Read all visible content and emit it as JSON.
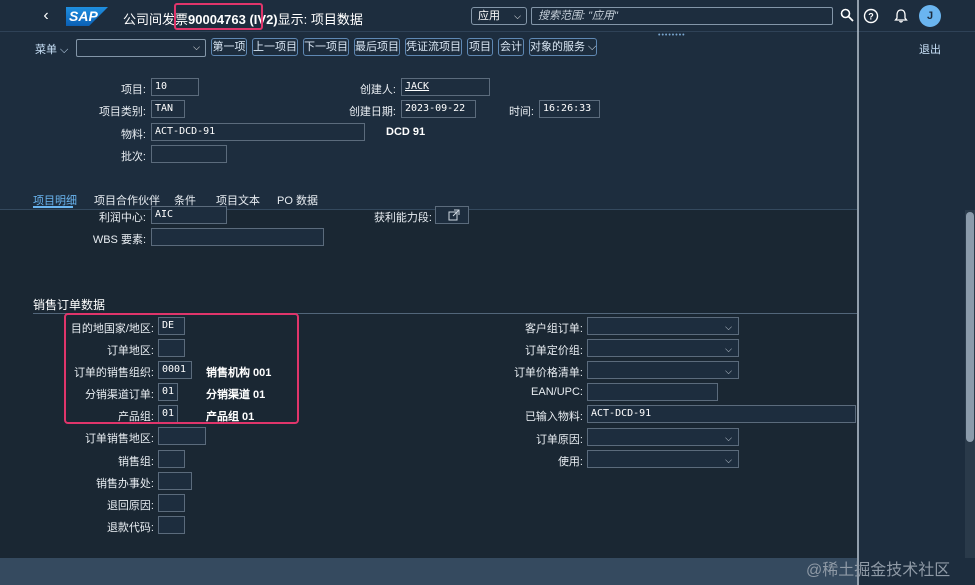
{
  "shell": {
    "title_prefix": "公司间发票",
    "doc_number": "90004763 (IV2)",
    "title_suffix": "显示: 项目数据",
    "scope": "应用",
    "search_placeholder": "搜索范围: \"应用\"",
    "avatar_initial": "J",
    "icons": [
      "back-icon",
      "search-icon",
      "help-icon",
      "bell-icon",
      "chevron-down-icon"
    ]
  },
  "toolbar": {
    "menu": "菜单",
    "buttons": [
      "第一项",
      "上一项目",
      "下一项目",
      "最后项目",
      "凭证流项目",
      "项目",
      "会计",
      "对象的服务"
    ],
    "exit": "退出"
  },
  "header": {
    "item_label": "项目:",
    "item_value": "10",
    "item_cat_label": "项目类别:",
    "item_cat_value": "TAN",
    "material_label": "物料:",
    "material_value": "ACT-DCD-91",
    "material_desc": "DCD 91",
    "batch_label": "批次:",
    "created_by_label": "创建人:",
    "created_by_value": "JACK",
    "created_on_label": "创建日期:",
    "created_on_value": "2023-09-22",
    "time_label": "时间:",
    "time_value": "16:26:33"
  },
  "tabs": [
    "项目明细",
    "项目合作伙伴",
    "条件",
    "项目文本",
    "PO 数据"
  ],
  "item_detail": {
    "profit_center_label": "利润中心:",
    "profit_center_value": "AIC",
    "profitability_label": "获利能力段:",
    "wbs_label": "WBS 要素:",
    "section_title": "销售订单数据",
    "left": [
      {
        "label": "目的地国家/地区:",
        "value": "DE",
        "desc": ""
      },
      {
        "label": "订单地区:",
        "value": "",
        "desc": ""
      },
      {
        "label": "订单的销售组织:",
        "value": "0001",
        "desc": "销售机构 001"
      },
      {
        "label": "分销渠道订单:",
        "value": "01",
        "desc": "分销渠道 01"
      },
      {
        "label": "产品组:",
        "value": "01",
        "desc": "产品组 01"
      },
      {
        "label": "订单销售地区:",
        "value": "",
        "desc": ""
      },
      {
        "label": "销售组:",
        "value": "",
        "desc": ""
      },
      {
        "label": "销售办事处:",
        "value": "",
        "desc": ""
      },
      {
        "label": "退回原因:",
        "value": "",
        "desc": ""
      },
      {
        "label": "退款代码:",
        "value": "",
        "desc": ""
      }
    ],
    "right": [
      {
        "label": "客户组订单:",
        "value": ""
      },
      {
        "label": "订单定价组:",
        "value": ""
      },
      {
        "label": "订单价格清单:",
        "value": ""
      },
      {
        "label": "EAN/UPC:",
        "value": ""
      },
      {
        "label": "已输入物料:",
        "value": "ACT-DCD-91"
      },
      {
        "label": "订单原因:",
        "value": ""
      },
      {
        "label": "使用:",
        "value": ""
      }
    ]
  },
  "watermark": "@稀土掘金技术社区"
}
